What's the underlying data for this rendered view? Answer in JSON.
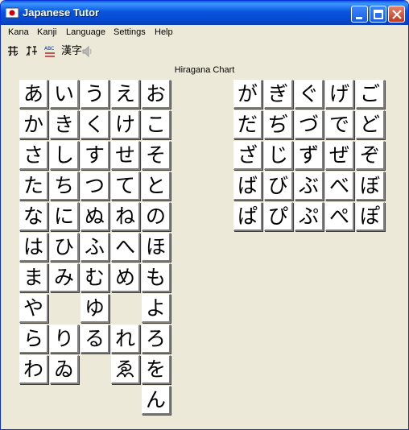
{
  "window": {
    "title": "Japanese Tutor"
  },
  "menu": [
    {
      "label": "Kana",
      "name": "menu-kana"
    },
    {
      "label": "Kanji",
      "name": "menu-kanji"
    },
    {
      "label": "Language",
      "name": "menu-language"
    },
    {
      "label": "Settings",
      "name": "menu-settings"
    },
    {
      "label": "Help",
      "name": "menu-help"
    }
  ],
  "toolbar": {
    "kana_chart_icon": "kana-chart-icon",
    "kana_quiz_icon": "kana-quiz-icon",
    "spell_icon": "spell-check-icon",
    "kanji_label": "漢字",
    "speaker_icon": "speaker-icon"
  },
  "chart": {
    "title": "Hiragana Chart",
    "basic": [
      [
        "あ",
        "い",
        "う",
        "え",
        "お"
      ],
      [
        "か",
        "き",
        "く",
        "け",
        "こ"
      ],
      [
        "さ",
        "し",
        "す",
        "せ",
        "そ"
      ],
      [
        "た",
        "ち",
        "つ",
        "て",
        "と"
      ],
      [
        "な",
        "に",
        "ぬ",
        "ね",
        "の"
      ],
      [
        "は",
        "ひ",
        "ふ",
        "へ",
        "ほ"
      ],
      [
        "ま",
        "み",
        "む",
        "め",
        "も"
      ],
      [
        "や",
        "",
        "ゆ",
        "",
        "よ"
      ],
      [
        "ら",
        "り",
        "る",
        "れ",
        "ろ"
      ],
      [
        "わ",
        "ゐ",
        "",
        "ゑ",
        "を"
      ],
      [
        "",
        "",
        "",
        "",
        "ん"
      ]
    ],
    "voiced": [
      [
        "が",
        "ぎ",
        "ぐ",
        "げ",
        "ご"
      ],
      [
        "だ",
        "ぢ",
        "づ",
        "で",
        "ど"
      ],
      [
        "ざ",
        "じ",
        "ず",
        "ぜ",
        "ぞ"
      ],
      [
        "ば",
        "び",
        "ぶ",
        "べ",
        "ぼ"
      ],
      [
        "ぱ",
        "ぴ",
        "ぷ",
        "ぺ",
        "ぽ"
      ]
    ]
  }
}
